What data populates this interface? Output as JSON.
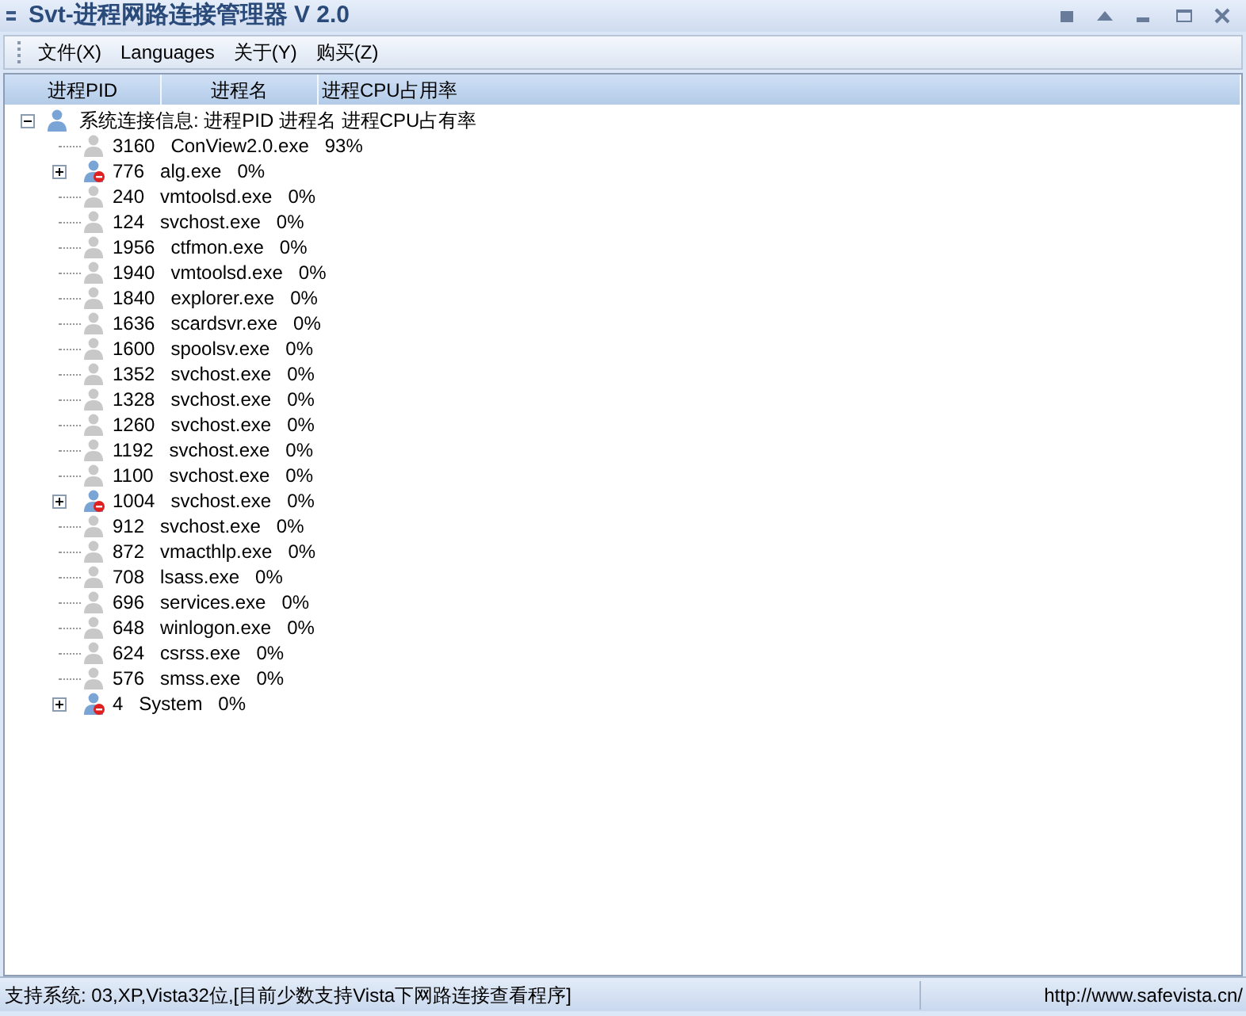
{
  "window": {
    "title": "Svt-进程网路连接管理器 V 2.0"
  },
  "menu": [
    "文件(X)",
    "Languages",
    "关于(Y)",
    "购买(Z)"
  ],
  "columns": [
    "进程PID",
    "进程名",
    "进程CPU占用率"
  ],
  "tree": {
    "label": "系统连接信息: 进程PID 进程名 进程CPU占有率",
    "expanded": true,
    "children": [
      {
        "label": "3160   ConView2.0.exe   93%",
        "kind": "plain"
      },
      {
        "label": "776   alg.exe   0%",
        "kind": "network",
        "expanded": false
      },
      {
        "label": "240   vmtoolsd.exe   0%",
        "kind": "plain"
      },
      {
        "label": "124   svchost.exe   0%",
        "kind": "plain"
      },
      {
        "label": "1956   ctfmon.exe   0%",
        "kind": "plain"
      },
      {
        "label": "1940   vmtoolsd.exe   0%",
        "kind": "plain"
      },
      {
        "label": "1840   explorer.exe   0%",
        "kind": "plain"
      },
      {
        "label": "1636   scardsvr.exe   0%",
        "kind": "plain"
      },
      {
        "label": "1600   spoolsv.exe   0%",
        "kind": "plain"
      },
      {
        "label": "1352   svchost.exe   0%",
        "kind": "plain"
      },
      {
        "label": "1328   svchost.exe   0%",
        "kind": "plain"
      },
      {
        "label": "1260   svchost.exe   0%",
        "kind": "plain"
      },
      {
        "label": "1192   svchost.exe   0%",
        "kind": "plain"
      },
      {
        "label": "1100   svchost.exe   0%",
        "kind": "plain"
      },
      {
        "label": "1004   svchost.exe   0%",
        "kind": "network",
        "expanded": false
      },
      {
        "label": "912   svchost.exe   0%",
        "kind": "plain"
      },
      {
        "label": "872   vmacthlp.exe   0%",
        "kind": "plain"
      },
      {
        "label": "708   lsass.exe   0%",
        "kind": "plain"
      },
      {
        "label": "696   services.exe   0%",
        "kind": "plain"
      },
      {
        "label": "648   winlogon.exe   0%",
        "kind": "plain"
      },
      {
        "label": "624   csrss.exe   0%",
        "kind": "plain"
      },
      {
        "label": "576   smss.exe   0%",
        "kind": "plain"
      },
      {
        "label": "4   System   0%",
        "kind": "network",
        "expanded": false
      }
    ]
  },
  "status_bar": [
    "支持系统: 03,XP,Vista32位,[目前少数支持Vista下网路连接查看程序]",
    "http://www.safevista.cn/"
  ]
}
